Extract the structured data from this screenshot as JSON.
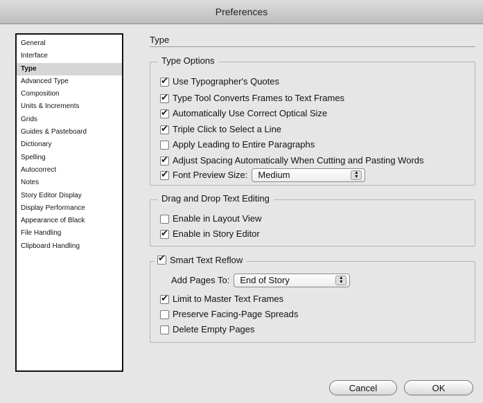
{
  "window": {
    "title": "Preferences"
  },
  "sidebar": {
    "items": [
      {
        "label": "General"
      },
      {
        "label": "Interface"
      },
      {
        "label": "Type",
        "selected": true
      },
      {
        "label": "Advanced Type"
      },
      {
        "label": "Composition"
      },
      {
        "label": "Units & Increments"
      },
      {
        "label": "Grids"
      },
      {
        "label": "Guides & Pasteboard"
      },
      {
        "label": "Dictionary"
      },
      {
        "label": "Spelling"
      },
      {
        "label": "Autocorrect"
      },
      {
        "label": "Notes"
      },
      {
        "label": "Story Editor Display"
      },
      {
        "label": "Display Performance"
      },
      {
        "label": "Appearance of Black"
      },
      {
        "label": "File Handling"
      },
      {
        "label": "Clipboard Handling"
      }
    ]
  },
  "panel": {
    "title": "Type"
  },
  "type_options": {
    "legend": "Type Options",
    "use_quotes": {
      "label": "Use Typographer's Quotes",
      "checked": true
    },
    "type_tool": {
      "label": "Type Tool Converts Frames to Text Frames",
      "checked": true
    },
    "optical_size": {
      "label": "Automatically Use Correct Optical Size",
      "checked": true
    },
    "triple_click": {
      "label": "Triple Click to Select a Line",
      "checked": true
    },
    "leading": {
      "label": "Apply Leading to Entire Paragraphs",
      "checked": false
    },
    "adjust_spacing": {
      "label": "Adjust Spacing Automatically When Cutting and Pasting Words",
      "checked": true
    },
    "font_preview": {
      "label": "Font Preview Size:",
      "checked": true,
      "value": "Medium"
    }
  },
  "drag_drop": {
    "legend": "Drag and Drop Text Editing",
    "layout_view": {
      "label": "Enable in Layout View",
      "checked": false
    },
    "story_editor": {
      "label": "Enable in Story Editor",
      "checked": true
    }
  },
  "smart_reflow": {
    "legend": "Smart Text Reflow",
    "checked": true,
    "add_pages_label": "Add Pages To:",
    "add_pages_value": "End of Story",
    "limit_master": {
      "label": "Limit to Master Text Frames",
      "checked": true
    },
    "preserve_spreads": {
      "label": "Preserve Facing-Page Spreads",
      "checked": false
    },
    "delete_empty": {
      "label": "Delete Empty Pages",
      "checked": false
    }
  },
  "buttons": {
    "cancel": "Cancel",
    "ok": "OK"
  }
}
